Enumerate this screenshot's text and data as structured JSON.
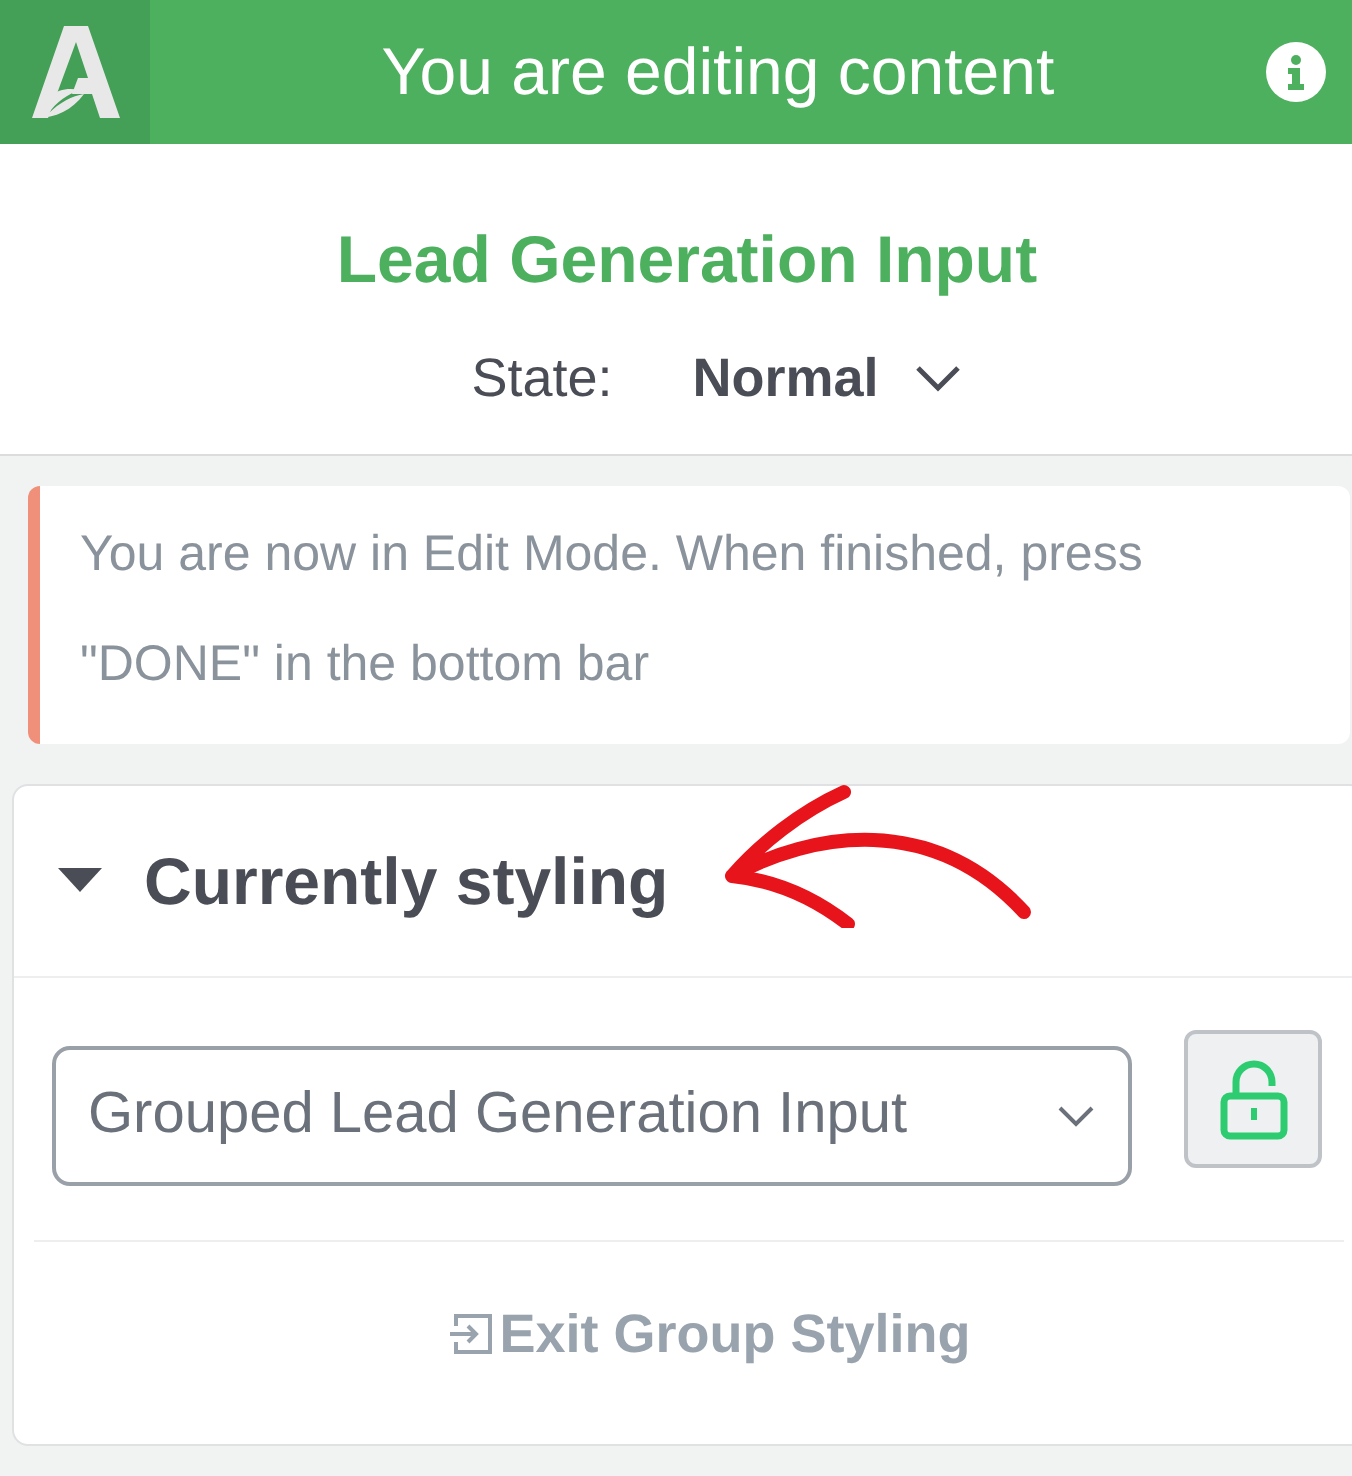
{
  "header": {
    "title": "You are editing content"
  },
  "element": {
    "title": "Lead Generation Input",
    "state_label": "State:",
    "state_value": "Normal"
  },
  "notice": {
    "text": "You are now in Edit Mode. When finished, press \"DONE\" in the bottom bar"
  },
  "section": {
    "title": "Currently styling",
    "expanded": true,
    "select_value": "Grouped Lead Generation Input",
    "locked": false,
    "exit_label": "Exit Group Styling"
  }
}
